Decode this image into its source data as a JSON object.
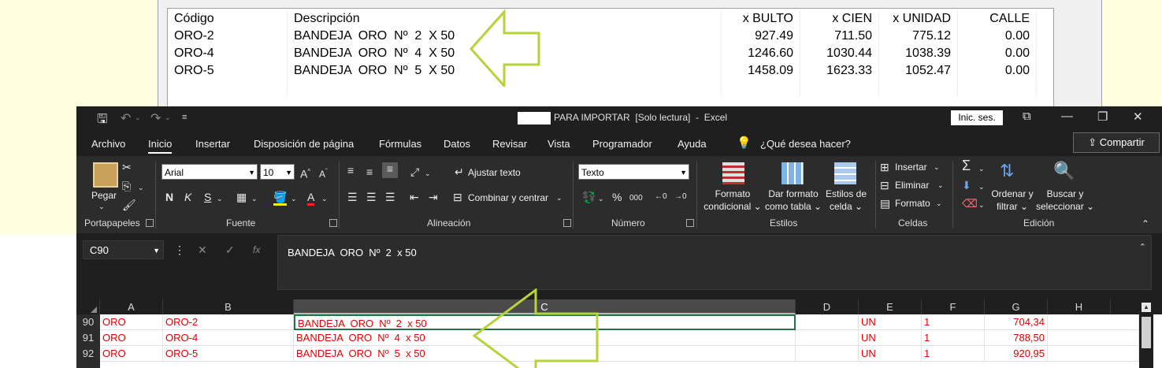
{
  "legacy_table": {
    "columns": [
      "Código",
      "Descripción",
      "x BULTO",
      "x CIEN",
      "x UNIDAD",
      "CALLE"
    ],
    "rows": [
      [
        "ORO-2",
        "BANDEJA  ORO  Nº  2  X 50",
        "927.49",
        "711.50",
        "775.12",
        "0.00"
      ],
      [
        "ORO-4",
        "BANDEJA  ORO  Nº  4  X 50",
        "1246.60",
        "1030.44",
        "1038.39",
        "0.00"
      ],
      [
        "ORO-5",
        "BANDEJA  ORO  Nº  5  X 50",
        "1458.09",
        "1623.33",
        "1052.47",
        "0.00"
      ]
    ]
  },
  "excel": {
    "title": "PARA IMPORTAR  [Solo lectura]  -  Excel",
    "signin_label": "Inic. ses.",
    "menu": [
      "Archivo",
      "Inicio",
      "Insertar",
      "Disposición de página",
      "Fórmulas",
      "Datos",
      "Revisar",
      "Vista",
      "Programador",
      "Ayuda"
    ],
    "tell_me": "¿Qué desea hacer?",
    "share_label": "Compartir",
    "ribbon": {
      "paste_label": "Pegar",
      "font_name": "Arial",
      "font_size": "10",
      "wrap_text": "Ajustar texto",
      "merge_center": "Combinar y centrar",
      "number_format": "Texto",
      "cond_format_1": "Formato",
      "cond_format_2": "condicional",
      "table_format_1": "Dar formato",
      "table_format_2": "como tabla",
      "cell_styles_1": "Estilos de",
      "cell_styles_2": "celda",
      "insert": "Insertar",
      "delete": "Eliminar",
      "format": "Formato",
      "sort_1": "Ordenar y",
      "sort_2": "filtrar",
      "find_1": "Buscar y",
      "find_2": "seleccionar",
      "groups": [
        "Portapapeles",
        "Fuente",
        "Alineación",
        "Número",
        "Estilos",
        "Celdas",
        "Edición"
      ]
    },
    "name_box": "C90",
    "formula": "BANDEJA  ORO  Nº  2  x 50",
    "col_headers": [
      "A",
      "B",
      "C",
      "D",
      "E",
      "F",
      "G",
      "H"
    ],
    "rows": [
      {
        "num": "90",
        "a": "ORO",
        "b": "ORO-2",
        "c": "BANDEJA  ORO  Nº  2  x 50",
        "e": "UN",
        "f": "1",
        "g": "704,34"
      },
      {
        "num": "91",
        "a": "ORO",
        "b": "ORO-4",
        "c": "BANDEJA  ORO  Nº  4  x 50",
        "e": "UN",
        "f": "1",
        "g": "788,50"
      },
      {
        "num": "92",
        "a": "ORO",
        "b": "ORO-5",
        "c": "BANDEJA  ORO  Nº  5  x 50",
        "e": "UN",
        "f": "1",
        "g": "920,95"
      }
    ]
  },
  "colors": {
    "arrow": "#b5d33a",
    "excel_bg": "#1f1f1f",
    "cell_text": "#e00000",
    "active_border": "#217346"
  }
}
